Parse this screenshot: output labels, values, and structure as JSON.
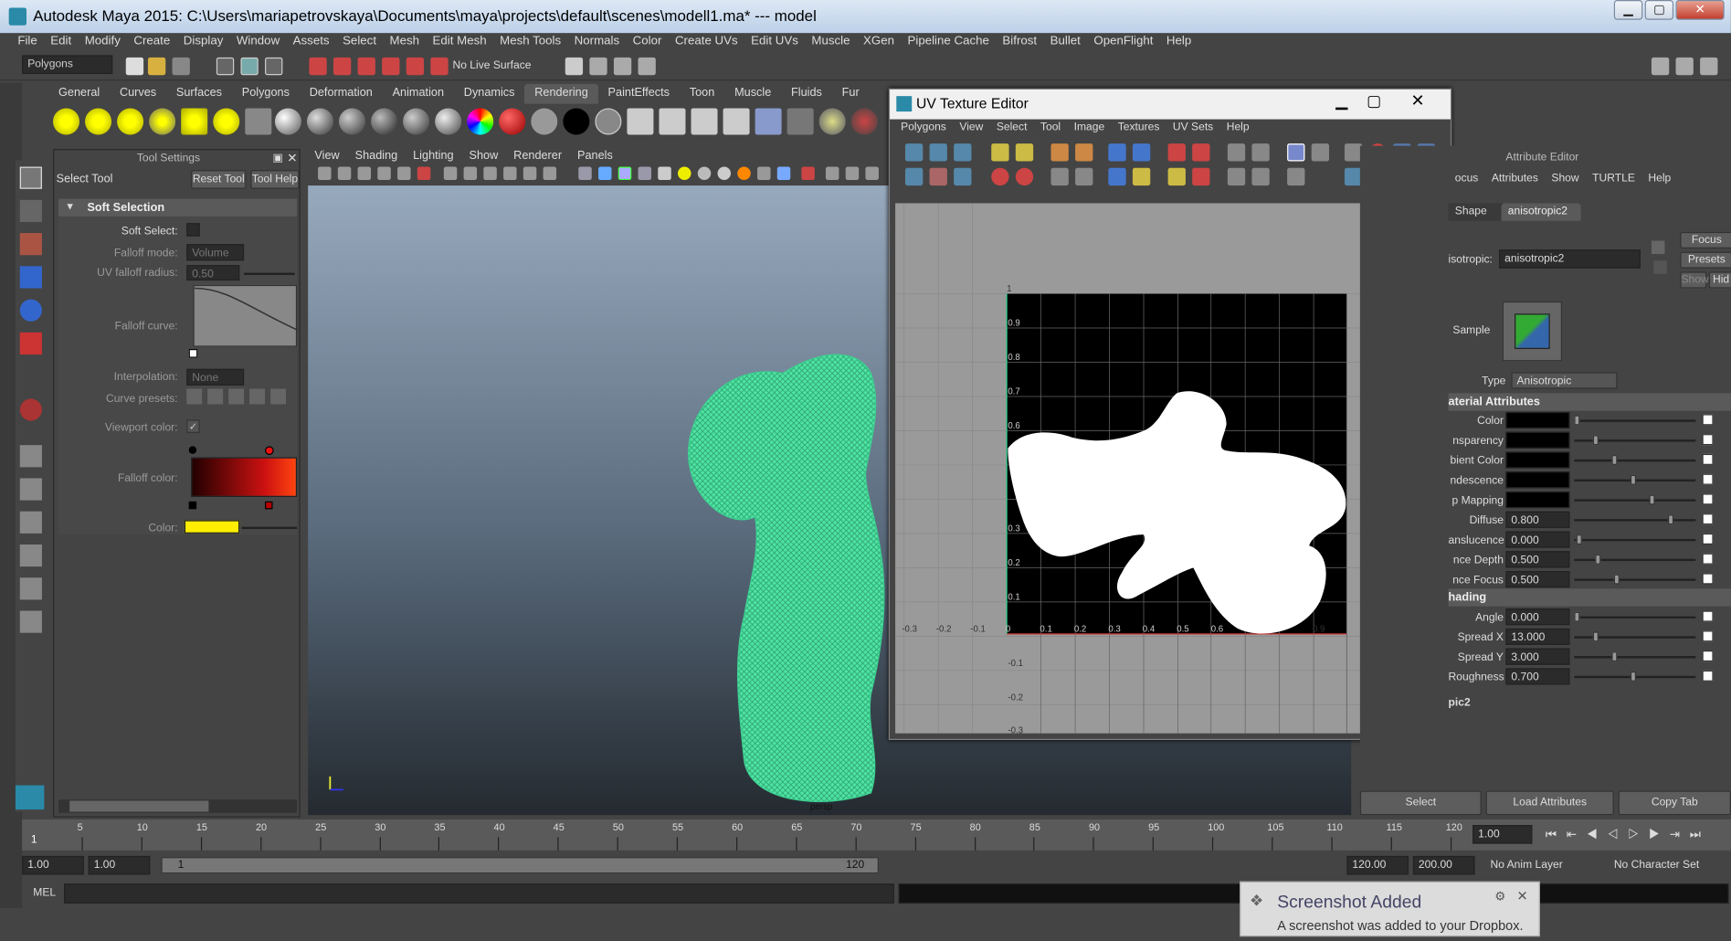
{
  "window": {
    "title": "Autodesk Maya 2015: C:\\Users\\mariapetrovskaya\\Documents\\maya\\projects\\default\\scenes\\modell1.ma*   ---   model",
    "min": "▁",
    "max": "▢",
    "close": "✕"
  },
  "menubar": [
    "File",
    "Edit",
    "Modify",
    "Create",
    "Display",
    "Window",
    "Assets",
    "Select",
    "Mesh",
    "Edit Mesh",
    "Mesh Tools",
    "Normals",
    "Color",
    "Create UVs",
    "Edit UVs",
    "Muscle",
    "XGen",
    "Pipeline Cache",
    "Bifrost",
    "Bullet",
    "OpenFlight",
    "Help"
  ],
  "toolbar": {
    "mode": "Polygons",
    "live_surface": "No Live Surface"
  },
  "shelf_tabs": [
    "General",
    "Curves",
    "Surfaces",
    "Polygons",
    "Deformation",
    "Animation",
    "Dynamics",
    "Rendering",
    "PaintEffects",
    "Toon",
    "Muscle",
    "Fluids",
    "Fur"
  ],
  "shelf_active": "Rendering",
  "tool_settings": {
    "header": "Tool Settings",
    "tool_name": "Select Tool",
    "reset": "Reset Tool",
    "help": "Tool Help",
    "section": "Soft Selection",
    "soft_select": "Soft Select:",
    "falloff_mode_label": "Falloff mode:",
    "falloff_mode": "Volume",
    "uv_radius_label": "UV falloff radius:",
    "uv_radius": "0.50",
    "falloff_curve": "Falloff curve:",
    "interpolation_label": "Interpolation:",
    "interpolation": "None",
    "curve_presets": "Curve presets:",
    "viewport_color": "Viewport color:",
    "falloff_color": "Falloff color:",
    "color": "Color:",
    "color_value": "#ffee00"
  },
  "viewport_menu": [
    "View",
    "Shading",
    "Lighting",
    "Show",
    "Renderer",
    "Panels"
  ],
  "viewport_label": "persp",
  "uv_editor": {
    "title": "UV Texture Editor",
    "menu": [
      "Polygons",
      "View",
      "Select",
      "Tool",
      "Image",
      "Textures",
      "UV Sets",
      "Help"
    ],
    "ticks_x": [
      "-0.3",
      "-0.2",
      "-0.1",
      "0",
      "0.1",
      "0.2",
      "0.3",
      "0.4",
      "0.5",
      "0.6",
      "0.9"
    ],
    "ticks_y": [
      "1",
      "0.9",
      "0.8",
      "0.7",
      "0.6",
      "0.3",
      "0.2",
      "0.1",
      "-0.1",
      "-0.2",
      "-0.3"
    ]
  },
  "attribute_editor": {
    "header": "Attribute Editor",
    "menu": [
      "ocus",
      "Attributes",
      "Show",
      "TURTLE",
      "Help"
    ],
    "tabs": [
      "Shape",
      "anisotropic2"
    ],
    "node_label": "isotropic:",
    "node_value": "anisotropic2",
    "focus": "Focus",
    "presets": "Presets",
    "show": "Show",
    "hide": "Hid",
    "sample": "Sample",
    "type_label": "Type",
    "type_value": "Anisotropic",
    "section1": "aterial Attributes",
    "rows1": [
      {
        "label": "Color",
        "value": ""
      },
      {
        "label": "nsparency",
        "value": ""
      },
      {
        "label": "bient Color",
        "value": ""
      },
      {
        "label": "ndescence",
        "value": ""
      },
      {
        "label": "p Mapping",
        "value": ""
      },
      {
        "label": "Diffuse",
        "value": "0.800"
      },
      {
        "label": "anslucence",
        "value": "0.000"
      },
      {
        "label": "nce Depth",
        "value": "0.500"
      },
      {
        "label": "nce Focus",
        "value": "0.500"
      }
    ],
    "section2": "hading",
    "rows2": [
      {
        "label": "Angle",
        "value": "0.000"
      },
      {
        "label": "Spread X",
        "value": "13.000"
      },
      {
        "label": "Spread Y",
        "value": "3.000"
      },
      {
        "label": "Roughness",
        "value": "0.700"
      }
    ],
    "section3": "pic2",
    "btn_select": "Select",
    "btn_load": "Load Attributes",
    "btn_copy": "Copy Tab"
  },
  "timeline": {
    "ticks": [
      "5",
      "10",
      "15",
      "20",
      "25",
      "30",
      "35",
      "40",
      "45",
      "50",
      "55",
      "60",
      "65",
      "70",
      "75",
      "80",
      "85",
      "90",
      "95",
      "100",
      "105",
      "110",
      "115",
      "120"
    ],
    "current": "1",
    "frame_field": "1.00"
  },
  "range": {
    "start": "1.00",
    "start2": "1.00",
    "inner_start": "1",
    "inner_end": "120",
    "end": "120.00",
    "end2": "200.00",
    "anim_layer": "No Anim Layer",
    "char_set": "No Character Set"
  },
  "command": {
    "label": "MEL"
  },
  "notification": {
    "title": "Screenshot Added",
    "body": "A screenshot was added to your Dropbox."
  }
}
